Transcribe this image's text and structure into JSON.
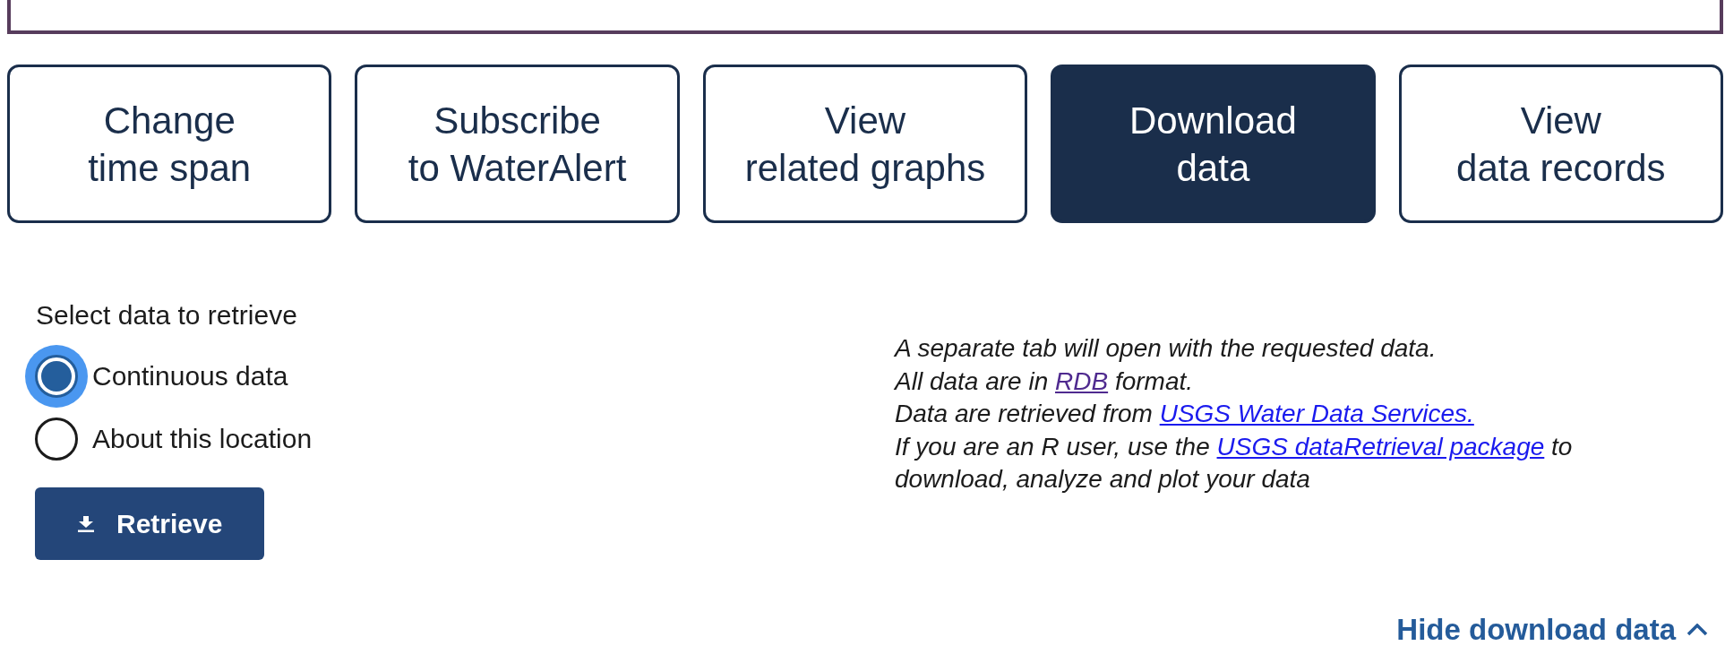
{
  "action_buttons": [
    {
      "label": "Change\ntime span",
      "selected": false
    },
    {
      "label": "Subscribe\nto WaterAlert",
      "selected": false
    },
    {
      "label": "View\nrelated graphs",
      "selected": false
    },
    {
      "label": "Download\ndata",
      "selected": true
    },
    {
      "label": "View\ndata records",
      "selected": false
    }
  ],
  "download_form": {
    "prompt": "Select data to retrieve",
    "options": [
      {
        "label": "Continuous data",
        "selected": true,
        "focused": true
      },
      {
        "label": "About this location",
        "selected": false,
        "focused": false
      }
    ],
    "submit": {
      "label": "Retrieve"
    }
  },
  "notes": [
    {
      "text": "A separate tab will open with the requested data."
    },
    {
      "text": "All data are in ",
      "link": {
        "label": "RDB",
        "visited": true
      },
      "after": " format."
    },
    {
      "text": "Data are retrieved from ",
      "link": {
        "label": "USGS Water Data Services.",
        "visited": false
      }
    },
    {
      "text": "If you are an R user, use the ",
      "link": {
        "label": "USGS dataRetrieval package",
        "visited": false
      },
      "after": " to download, analyze and plot your data"
    }
  ],
  "toggle": {
    "label": "Hide download data",
    "expanded": true
  }
}
